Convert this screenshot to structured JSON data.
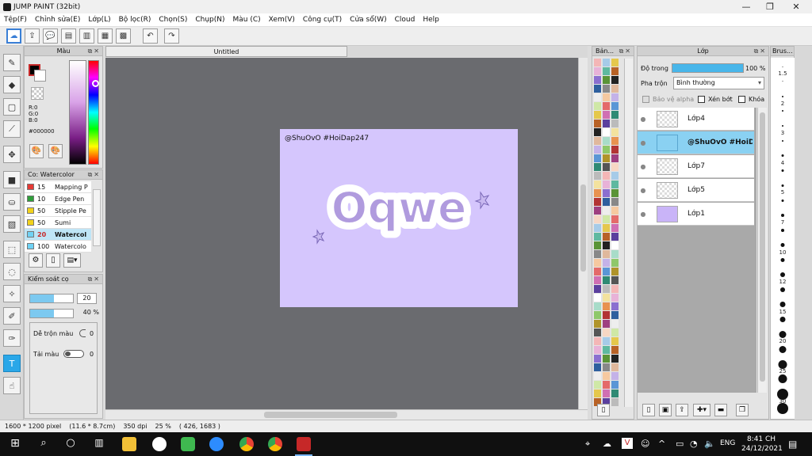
{
  "window": {
    "title": "JUMP PAINT (32bit)"
  },
  "menu": [
    "Tệp(F)",
    "Chỉnh sửa(E)",
    "Lớp(L)",
    "Bộ lọc(R)",
    "Chọn(S)",
    "Chụp(N)",
    "Màu (C)",
    "Xem(V)",
    "Công cụ(T)",
    "Cửa sổ(W)",
    "Cloud",
    "Help"
  ],
  "document": {
    "tab_title": "Untitled",
    "watermark": "@ShuOvO #HoiDap247",
    "art_text": "Oqwe"
  },
  "color_panel": {
    "title": "Màu",
    "r": "R:0",
    "g": "G:0",
    "b": "B:0",
    "hex": "#000000"
  },
  "brush_panel": {
    "title": "Co: Watercolor",
    "items": [
      {
        "size": "15",
        "name": "Mapping P",
        "color": "#e53935"
      },
      {
        "size": "10",
        "name": "Edge Pen",
        "color": "#2e9e3a"
      },
      {
        "size": "50",
        "name": "Stipple Pe",
        "color": "#f2d21b"
      },
      {
        "size": "50",
        "name": "Sumi",
        "color": "#f2d21b"
      },
      {
        "size": "20",
        "name": "Watercol",
        "color": "#6fd2f5"
      },
      {
        "size": "100",
        "name": "Watercolo",
        "color": "#6fd2f5"
      }
    ]
  },
  "control_panel": {
    "title": "Kiểm soát cọ",
    "size_value": "20",
    "opacity_value": "40 %",
    "blend_label": "Dễ trộn màu",
    "blend_value": "0",
    "reload_label": "Tải màu",
    "reload_value": "0",
    "size_fill": 0.55,
    "opacity_fill": 0.55
  },
  "swatch_panel": {
    "title": "Bản..."
  },
  "layer_panel": {
    "title": "Lớp",
    "opacity_label": "Độ trong",
    "opacity_value": "100 %",
    "opacity_fill": 1.0,
    "blend_label": "Pha trộn",
    "blend_value": "Bình thường",
    "protect_alpha": "Bảo vệ alpha",
    "clip": "Xén bớt",
    "lock": "Khóa",
    "layers": [
      "Lớp4",
      "@ShuOvO #HoiDap",
      "Lớp7",
      "Lớp5",
      "Lớp1"
    ]
  },
  "brush_size_panel": {
    "title": "Brus...",
    "sizes": [
      "1.5",
      "",
      "2",
      "",
      "3",
      "",
      "4",
      "",
      "5",
      "",
      "7",
      "",
      "10",
      "",
      "12",
      "",
      "15",
      "",
      "20",
      "",
      "25",
      "",
      "30",
      ""
    ]
  },
  "status": {
    "size": "1600 * 1200 pixel",
    "cm": "(11.6 * 8.7cm)",
    "dpi": "350 dpi",
    "zoom": "25 %",
    "coords": "( 426, 1683 )"
  },
  "taskbar": {
    "lang": "ENG",
    "time": "8:41 CH",
    "date": "24/12/2021"
  },
  "colors": {
    "canvas_bg": "#6a6b6f",
    "artboard": "#d5c6fd",
    "selected": "#8ad1f2",
    "accent": "#2aa7e8"
  }
}
